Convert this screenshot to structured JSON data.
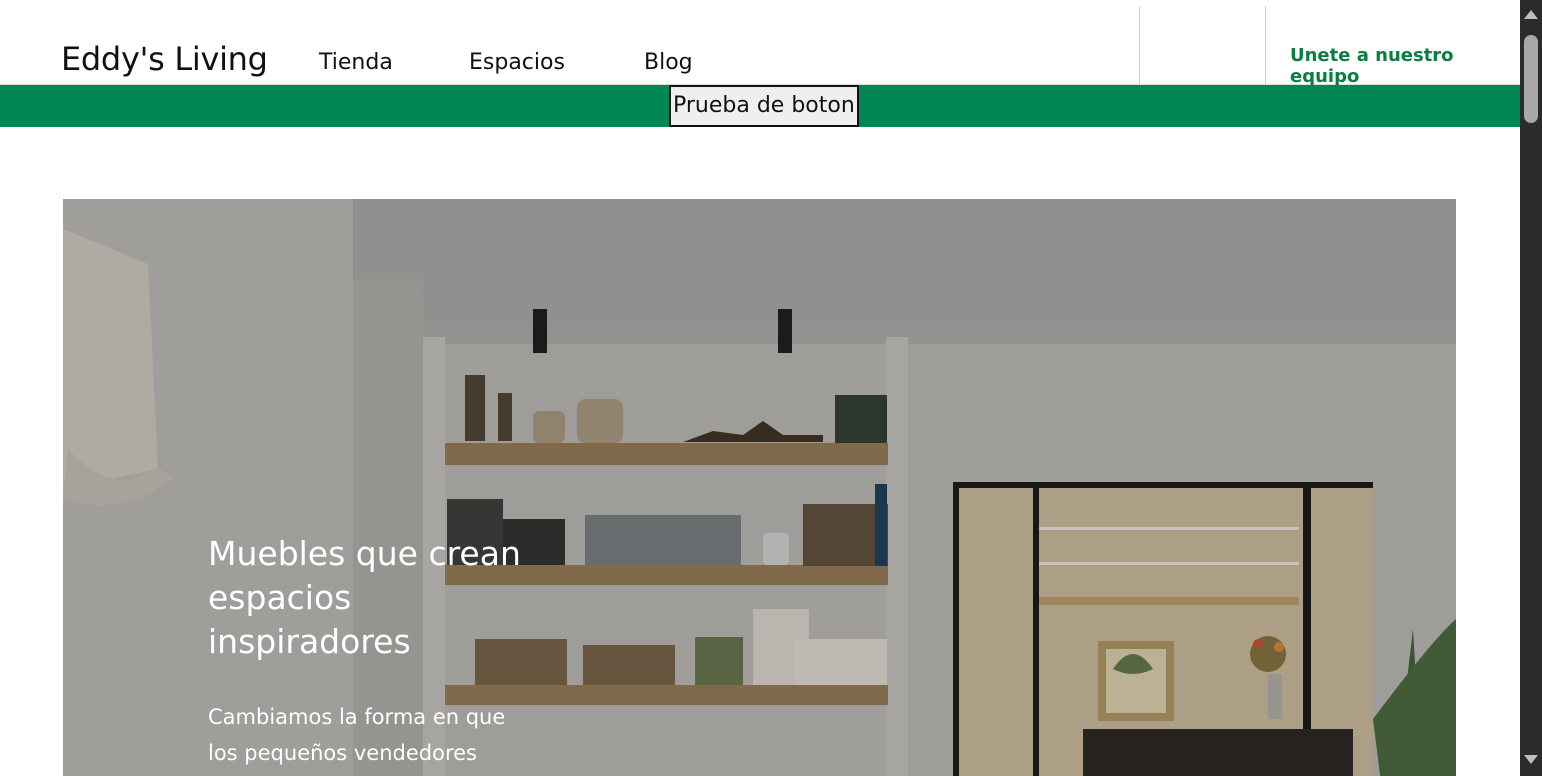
{
  "header": {
    "brand": "Eddy's Living",
    "nav": [
      {
        "label": "Tienda"
      },
      {
        "label": "Espacios"
      },
      {
        "label": "Blog"
      }
    ],
    "join_label": "Unete a nuestro equipo"
  },
  "banner": {
    "button_label": "Prueba de boton",
    "color": "#018754"
  },
  "hero": {
    "title": "Muebles que crean espacios inspiradores",
    "subtitle": "Cambiamos la forma en que los pequeños vendedores"
  },
  "colors": {
    "accent": "#018754",
    "link": "#0a7d43"
  }
}
